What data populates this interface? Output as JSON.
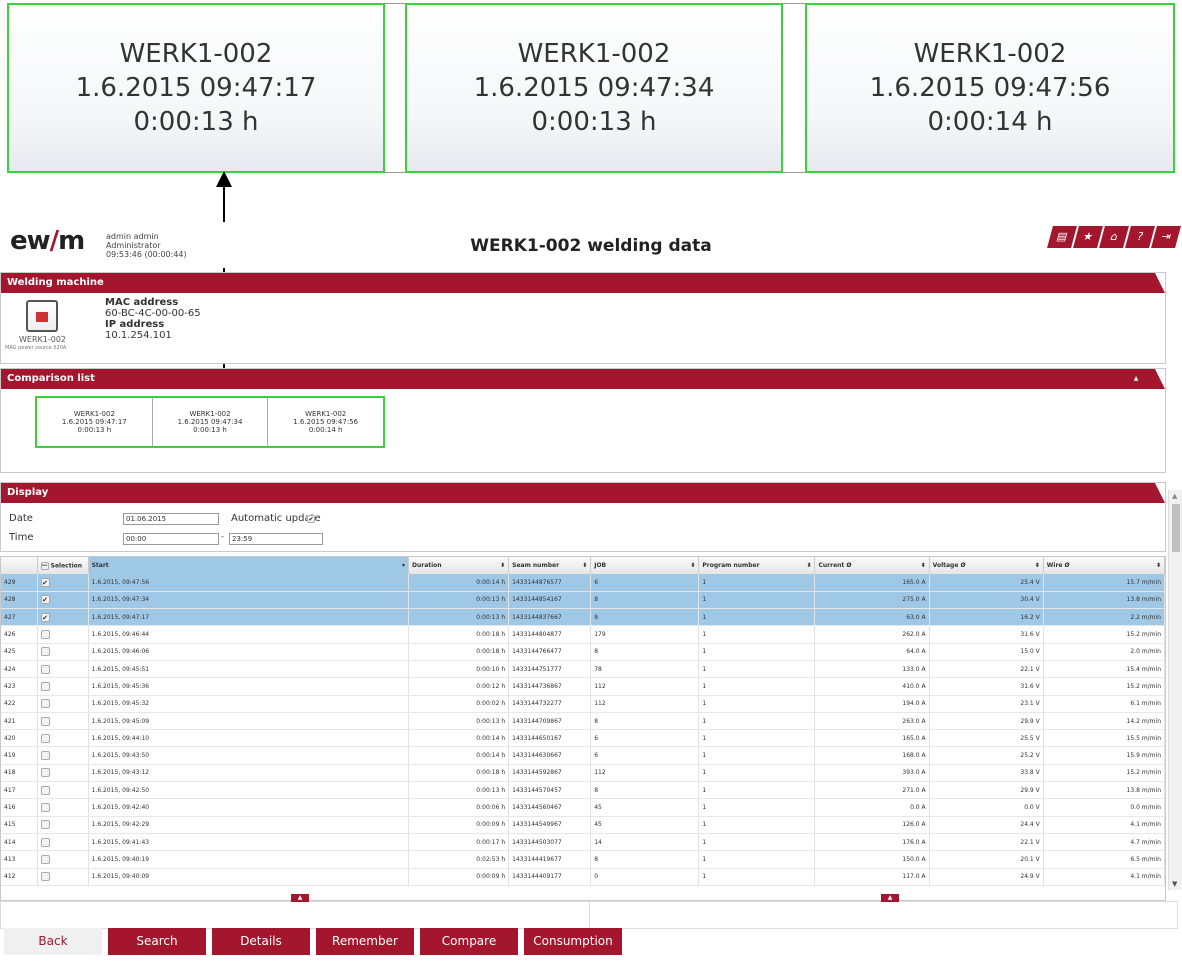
{
  "zoom": {
    "cards": [
      {
        "machine": "WERK1-002",
        "datetime": "1.6.2015 09:47:17",
        "duration": "0:00:13 h"
      },
      {
        "machine": "WERK1-002",
        "datetime": "1.6.2015 09:47:34",
        "duration": "0:00:13 h"
      },
      {
        "machine": "WERK1-002",
        "datetime": "1.6.2015 09:47:56",
        "duration": "0:00:14 h"
      }
    ]
  },
  "header": {
    "logo": "ewm",
    "user_name": "admin admin",
    "user_role": "Administrator",
    "user_time": "09:53:46 (00:00:44)",
    "title": "WERK1-002 welding data",
    "icons": [
      "print-icon",
      "star-icon",
      "home-icon",
      "help-icon",
      "logout-icon"
    ]
  },
  "machine": {
    "section_title": "Welding machine",
    "name": "WERK1-002",
    "type": "MAG power source 520A",
    "mac_label": "MAC address",
    "mac_value": "60-BC-4C-00-00-65",
    "ip_label": "IP address",
    "ip_value": "10.1.254.101"
  },
  "comparison": {
    "section_title": "Comparison list",
    "cards": [
      {
        "machine": "WERK1-002",
        "datetime": "1.6.2015 09:47:17",
        "duration": "0:00:13 h"
      },
      {
        "machine": "WERK1-002",
        "datetime": "1.6.2015 09:47:34",
        "duration": "0:00:13 h"
      },
      {
        "machine": "WERK1-002",
        "datetime": "1.6.2015 09:47:56",
        "duration": "0:00:14 h"
      }
    ]
  },
  "display": {
    "section_title": "Display",
    "date_label": "Date",
    "date_value": "01.06.2015",
    "auto_update_label": "Automatic update",
    "auto_update_checked": true,
    "time_label": "Time",
    "time_from": "00:00",
    "time_to": "23:59",
    "time_separator": "-"
  },
  "table": {
    "columns": [
      "",
      "Selection",
      "Start",
      "Duration",
      "Seam number",
      "JOB",
      "Program number",
      "Current Ø",
      "Voltage Ø",
      "Wire Ø"
    ],
    "rows": [
      {
        "id": "429",
        "checked": true,
        "start": "1.6.2015, 09:47:56",
        "duration": "0:00:14 h",
        "seam": "1433144876577",
        "job": "6",
        "program": "1",
        "current": "165.0 A",
        "voltage": "25.4 V",
        "wire": "15.7 m/min"
      },
      {
        "id": "428",
        "checked": true,
        "start": "1.6.2015, 09:47:34",
        "duration": "0:00:13 h",
        "seam": "1433144854167",
        "job": "8",
        "program": "1",
        "current": "275.0 A",
        "voltage": "30.4 V",
        "wire": "13.8 m/min"
      },
      {
        "id": "427",
        "checked": true,
        "start": "1.6.2015, 09:47:17",
        "duration": "0:00:13 h",
        "seam": "1433144837667",
        "job": "8",
        "program": "1",
        "current": "63.0 A",
        "voltage": "16.2 V",
        "wire": "2.2 m/min"
      },
      {
        "id": "426",
        "checked": false,
        "start": "1.6.2015, 09:46:44",
        "duration": "0:00:18 h",
        "seam": "1433144804877",
        "job": "179",
        "program": "1",
        "current": "262.0 A",
        "voltage": "31.6 V",
        "wire": "15.2 m/min"
      },
      {
        "id": "425",
        "checked": false,
        "start": "1.6.2015, 09:46:06",
        "duration": "0:00:18 h",
        "seam": "1433144766477",
        "job": "8",
        "program": "1",
        "current": "64.0 A",
        "voltage": "15.0 V",
        "wire": "2.0 m/min"
      },
      {
        "id": "424",
        "checked": false,
        "start": "1.6.2015, 09:45:51",
        "duration": "0:00:10 h",
        "seam": "1433144751777",
        "job": "78",
        "program": "1",
        "current": "133.0 A",
        "voltage": "22.1 V",
        "wire": "15.4 m/min"
      },
      {
        "id": "423",
        "checked": false,
        "start": "1.6.2015, 09:45:36",
        "duration": "0:00:12 h",
        "seam": "1433144736867",
        "job": "112",
        "program": "1",
        "current": "410.0 A",
        "voltage": "31.6 V",
        "wire": "15.2 m/min"
      },
      {
        "id": "422",
        "checked": false,
        "start": "1.6.2015, 09:45:32",
        "duration": "0:00:02 h",
        "seam": "1433144732277",
        "job": "112",
        "program": "1",
        "current": "194.0 A",
        "voltage": "23.1 V",
        "wire": "6.1 m/min"
      },
      {
        "id": "421",
        "checked": false,
        "start": "1.6.2015, 09:45:09",
        "duration": "0:00:13 h",
        "seam": "1433144709867",
        "job": "8",
        "program": "1",
        "current": "263.0 A",
        "voltage": "29.9 V",
        "wire": "14.2 m/min"
      },
      {
        "id": "420",
        "checked": false,
        "start": "1.6.2015, 09:44:10",
        "duration": "0:00:14 h",
        "seam": "1433144650167",
        "job": "6",
        "program": "1",
        "current": "165.0 A",
        "voltage": "25.5 V",
        "wire": "15.5 m/min"
      },
      {
        "id": "419",
        "checked": false,
        "start": "1.6.2015, 09:43:50",
        "duration": "0:00:14 h",
        "seam": "1433144630667",
        "job": "6",
        "program": "1",
        "current": "168.0 A",
        "voltage": "25.2 V",
        "wire": "15.9 m/min"
      },
      {
        "id": "418",
        "checked": false,
        "start": "1.6.2015, 09:43:12",
        "duration": "0:00:18 h",
        "seam": "1433144592867",
        "job": "112",
        "program": "1",
        "current": "393.0 A",
        "voltage": "33.8 V",
        "wire": "15.2 m/min"
      },
      {
        "id": "417",
        "checked": false,
        "start": "1.6.2015, 09:42:50",
        "duration": "0:00:13 h",
        "seam": "1433144570457",
        "job": "8",
        "program": "1",
        "current": "271.0 A",
        "voltage": "29.9 V",
        "wire": "13.8 m/min"
      },
      {
        "id": "416",
        "checked": false,
        "start": "1.6.2015, 09:42:40",
        "duration": "0:00:06 h",
        "seam": "1433144560467",
        "job": "45",
        "program": "1",
        "current": "0.0 A",
        "voltage": "0.0 V",
        "wire": "0.0 m/min"
      },
      {
        "id": "415",
        "checked": false,
        "start": "1.6.2015, 09:42:29",
        "duration": "0:00:09 h",
        "seam": "1433144549967",
        "job": "45",
        "program": "1",
        "current": "126.0 A",
        "voltage": "24.4 V",
        "wire": "4.1 m/min"
      },
      {
        "id": "414",
        "checked": false,
        "start": "1.6.2015, 09:41:43",
        "duration": "0:00:17 h",
        "seam": "1433144503077",
        "job": "14",
        "program": "1",
        "current": "176.0 A",
        "voltage": "22.1 V",
        "wire": "4.7 m/min"
      },
      {
        "id": "413",
        "checked": false,
        "start": "1.6.2015, 09:40:19",
        "duration": "0:02:53 h",
        "seam": "1433144419677",
        "job": "8",
        "program": "1",
        "current": "150.0 A",
        "voltage": "20.1 V",
        "wire": "6.5 m/min"
      },
      {
        "id": "412",
        "checked": false,
        "start": "1.6.2015, 09:40:09",
        "duration": "0:00:09 h",
        "seam": "1433144409177",
        "job": "0",
        "program": "1",
        "current": "117.0 A",
        "voltage": "24.9 V",
        "wire": "4.1 m/min"
      }
    ]
  },
  "buttons": {
    "back": "Back",
    "search": "Search",
    "details": "Details",
    "remember": "Remember",
    "compare": "Compare",
    "consumption": "Consumption"
  },
  "colors": {
    "brand": "#a3162d",
    "highlight": "#3bd13b",
    "selected_row": "#9fc7e6"
  }
}
